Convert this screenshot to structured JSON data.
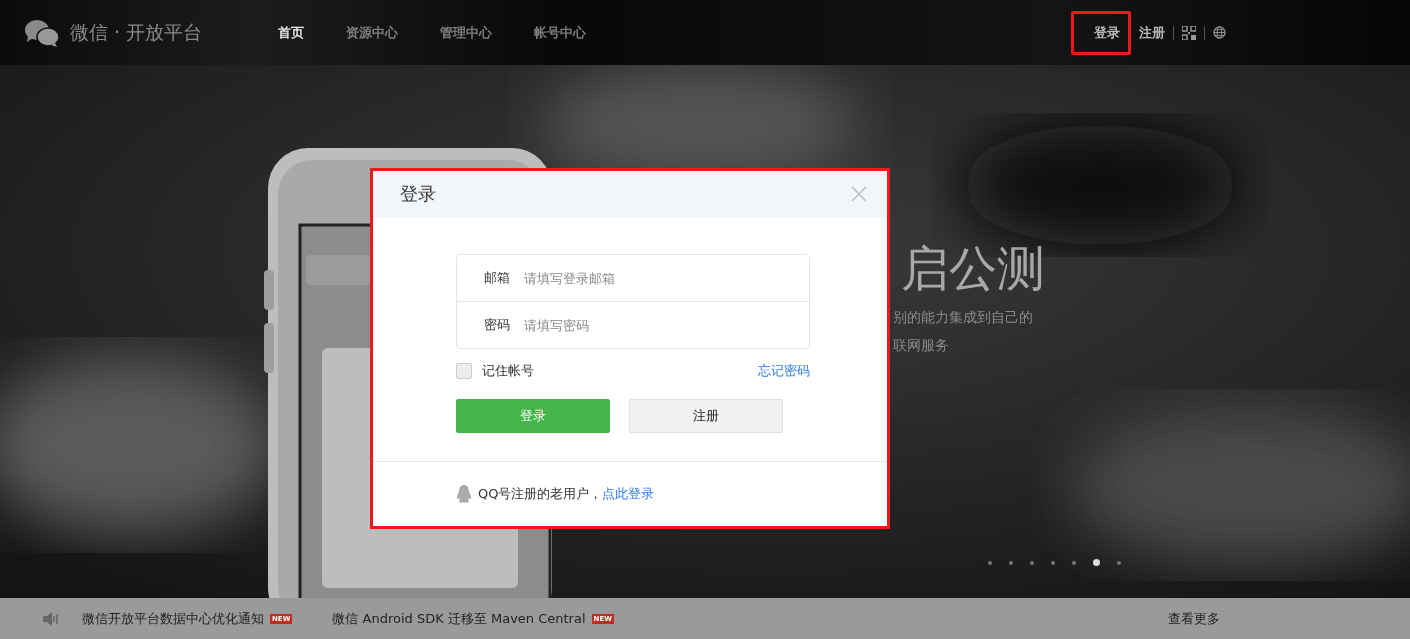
{
  "header": {
    "logo_text": "微信 · 开放平台",
    "nav": [
      {
        "label": "首页",
        "selected": true
      },
      {
        "label": "资源中心",
        "selected": false
      },
      {
        "label": "管理中心",
        "selected": false
      },
      {
        "label": "帐号中心",
        "selected": false
      }
    ],
    "account_links": [
      {
        "label": "登录",
        "highlighted": true
      },
      {
        "label": "注册",
        "highlighted": false
      }
    ]
  },
  "hero": {
    "headline": "启公测",
    "subtitle_lines": [
      "别的能力集成到自己的",
      "联网服务"
    ],
    "slides": [
      {
        "selected": false
      },
      {
        "selected": false
      },
      {
        "selected": false
      },
      {
        "selected": false
      },
      {
        "selected": false
      },
      {
        "selected": true
      },
      {
        "selected": false
      }
    ]
  },
  "login_dialog": {
    "title": "登录",
    "highlighted": true,
    "fields": [
      {
        "label": "邮箱",
        "placeholder": "请填写登录邮箱"
      },
      {
        "label": "密码",
        "placeholder": "请填写密码"
      }
    ],
    "remember": {
      "label": "记住帐号",
      "checked": false
    },
    "forgot_link": "忘记密码",
    "buttons": [
      {
        "label": "登录",
        "kind": "primary"
      },
      {
        "label": "注册",
        "kind": "secondary"
      }
    ],
    "qq_note": {
      "text": "QQ号注册的老用户，",
      "link": "点此登录"
    }
  },
  "notice_bar": {
    "items": [
      {
        "text": "微信开放平台数据中心优化通知",
        "badge": "NEW"
      },
      {
        "text": "微信 Android SDK 迁移至 Maven Central",
        "badge": "NEW"
      }
    ],
    "more_link": "查看更多"
  }
}
